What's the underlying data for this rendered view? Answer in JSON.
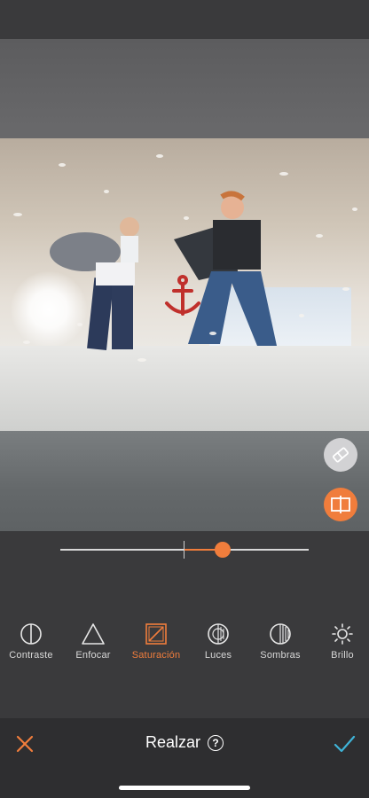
{
  "editor": {
    "slider": {
      "value_fraction": 0.655,
      "center_fraction": 0.5
    },
    "tools": [
      {
        "label": "Contraste",
        "icon": "contrast-icon",
        "active": false
      },
      {
        "label": "Enfocar",
        "icon": "sharpen-icon",
        "active": false
      },
      {
        "label": "Saturación",
        "icon": "saturation-icon",
        "active": true
      },
      {
        "label": "Luces",
        "icon": "highlights-icon",
        "active": false
      },
      {
        "label": "Sombras",
        "icon": "shadows-icon",
        "active": false
      },
      {
        "label": "Brillo",
        "icon": "brightness-icon",
        "active": false
      }
    ]
  },
  "bottom_bar": {
    "title": "Realzar",
    "help": "?"
  },
  "colors": {
    "accent": "#f07d3c",
    "confirm": "#3fb4d8",
    "panel": "#3a3a3c"
  }
}
